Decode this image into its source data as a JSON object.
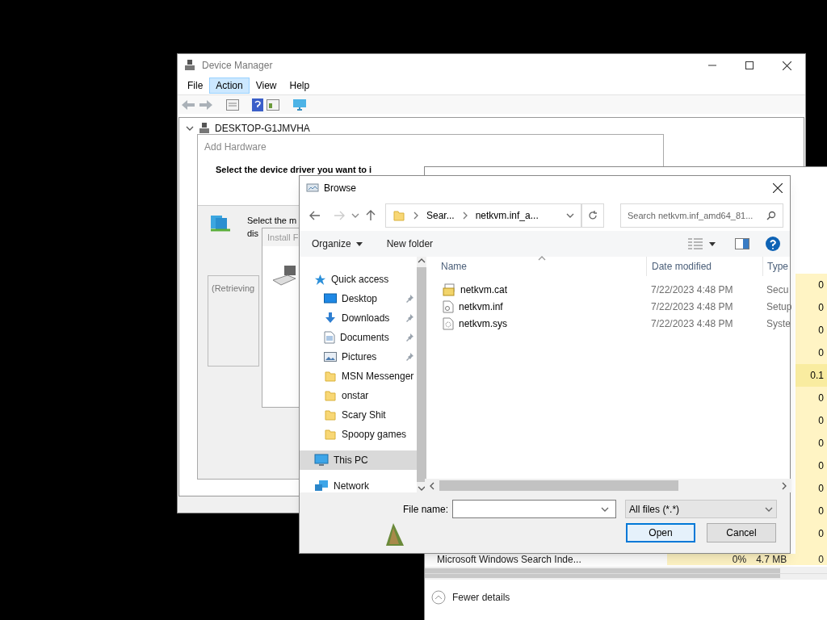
{
  "device_manager": {
    "title": "Device Manager",
    "menu": [
      {
        "label": "File",
        "selected": false
      },
      {
        "label": "Action",
        "selected": true
      },
      {
        "label": "View",
        "selected": false
      },
      {
        "label": "Help",
        "selected": false
      }
    ],
    "tree_root": "DESKTOP-G1JMVHA"
  },
  "add_hardware": {
    "title": "Add Hardware",
    "heading": "Select the device driver you want to i",
    "instruction": [
      "Select the m",
      "dis"
    ],
    "list_text": "(Retrieving"
  },
  "install_disk": {
    "title": "Install F"
  },
  "task_manager": {
    "rows": [
      {
        "value": "0",
        "highlight": false
      },
      {
        "value": "0",
        "highlight": false
      },
      {
        "value": "0",
        "highlight": false
      },
      {
        "value": "0",
        "highlight": false
      },
      {
        "value": "0.1",
        "highlight": true
      },
      {
        "value": "0",
        "highlight": false
      },
      {
        "value": "0",
        "highlight": false
      },
      {
        "value": "0",
        "highlight": false
      },
      {
        "value": "0",
        "highlight": false
      },
      {
        "value": "0",
        "highlight": false
      },
      {
        "value": "0",
        "highlight": false
      },
      {
        "value": "0",
        "highlight": false
      }
    ],
    "last_row": {
      "name": "Microsoft Windows Search Inde...",
      "cpu": "0%",
      "memory": "4.7 MB",
      "value": "0"
    },
    "fewer_details": "Fewer details"
  },
  "browse": {
    "title": "Browse",
    "path": [
      "Sear...",
      "netkvm.inf_a..."
    ],
    "search_placeholder": "Search netkvm.inf_amd64_81...",
    "toolbar": [
      "Organize",
      "New folder"
    ],
    "nav": [
      {
        "label": "Quick access",
        "kind": "quick",
        "selected": false,
        "children": [
          {
            "label": "Desktop",
            "kind": "desktop",
            "pinned": true,
            "selected": false
          },
          {
            "label": "Downloads",
            "kind": "downloads",
            "pinned": true,
            "selected": false
          },
          {
            "label": "Documents",
            "kind": "documents",
            "pinned": true,
            "selected": false
          },
          {
            "label": "Pictures",
            "kind": "pictures",
            "pinned": true,
            "selected": false
          },
          {
            "label": "MSN Messenger",
            "kind": "folder",
            "pinned": false,
            "selected": false
          },
          {
            "label": "onstar",
            "kind": "folder",
            "pinned": false,
            "selected": false
          },
          {
            "label": "Scary Shit",
            "kind": "folder",
            "pinned": false,
            "selected": false
          },
          {
            "label": "Spoopy games",
            "kind": "folder",
            "pinned": false,
            "selected": false
          }
        ]
      },
      {
        "label": "This PC",
        "kind": "pc",
        "selected": true
      },
      {
        "label": "Network",
        "kind": "network",
        "selected": false
      }
    ],
    "columns": [
      "Name",
      "Date modified",
      "Type"
    ],
    "files": [
      {
        "name": "netkvm.cat",
        "date": "7/22/2023 4:48 PM",
        "type": "Secu",
        "kind": "catalog"
      },
      {
        "name": "netkvm.inf",
        "date": "7/22/2023 4:48 PM",
        "type": "Setup",
        "kind": "setup"
      },
      {
        "name": "netkvm.sys",
        "date": "7/22/2023 4:48 PM",
        "type": "Syste",
        "kind": "system"
      }
    ],
    "file_name_label": "File name:",
    "file_type": "All files (*.*)",
    "buttons": [
      {
        "label": "Open",
        "default": true
      },
      {
        "label": "Cancel",
        "default": false
      }
    ]
  }
}
